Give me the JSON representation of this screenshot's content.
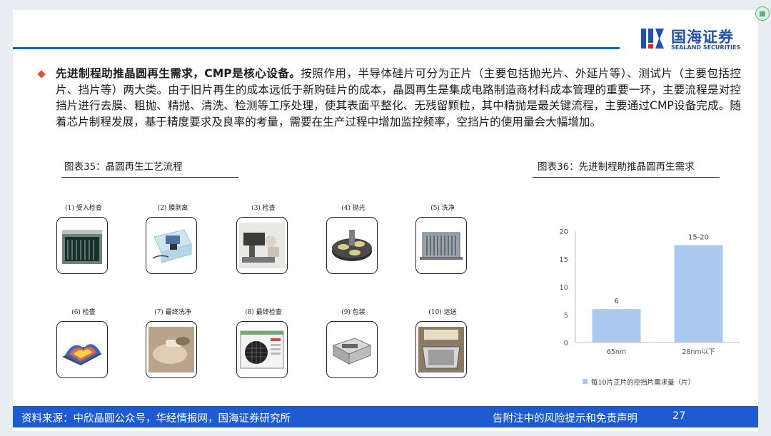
{
  "logo": {
    "cn": "国海证券",
    "en": "SEALAND SECURITIES"
  },
  "intro": {
    "lead": "先进制程助推晶圆再生需求，CMP是核心设备。",
    "text": "按照作用，半导体硅片可分为正片（主要包括抛光片、外延片等）、测试片（主要包括控片、挡片等）两大类。由于旧片再生的成本远低于新购硅片的成本，晶圆再生是集成电路制造商材料成本管理的重要一环，主要流程是对控挡片进行去膜、粗抛、精抛、清洗、检测等工序处理，使其表面平整化、无残留颗粒，其中精抛是最关键流程，主要通过CMP设备完成。随着芯片制程发展，基于精度要求及良率的考量，需要在生产过程中增加监控频率，空挡片的使用量会大幅增加。"
  },
  "figure35": {
    "title": "图表35：晶圆再生工艺流程",
    "steps": [
      {
        "label": "(1) 受入检查",
        "icon": "wafer-cassette"
      },
      {
        "label": "(2) 膜剥离",
        "icon": "film-strip-tank"
      },
      {
        "label": "(3) 检查",
        "icon": "microscope"
      },
      {
        "label": "(4) 抛光",
        "icon": "polishing-pad"
      },
      {
        "label": "(5) 洗净",
        "icon": "cleaning-rack"
      },
      {
        "label": "(6) 检查",
        "icon": "surface-map"
      },
      {
        "label": "(7) 最终洗净",
        "icon": "final-clean"
      },
      {
        "label": "(8) 最终检查",
        "icon": "inspection-screen"
      },
      {
        "label": "(9) 包装",
        "icon": "packaging-box"
      },
      {
        "label": "(10) 运送",
        "icon": "shipping-box"
      }
    ]
  },
  "figure36": {
    "title": "图表36：先进制程助推晶圆再生需求"
  },
  "chart_data": {
    "type": "bar",
    "categories": [
      "65nm",
      "28nm以下"
    ],
    "series": [
      {
        "name": "每10片正片的控挡片需求量（片）",
        "values": [
          6,
          17.5
        ],
        "value_labels": [
          "6",
          "15-20"
        ],
        "color": "#a9c9ef"
      }
    ],
    "ylim": [
      0,
      20
    ],
    "yticks": [
      "0",
      "5",
      "10",
      "15",
      "20"
    ],
    "legend": "bottom",
    "grid": false
  },
  "footer": {
    "source": "资料来源：中欣晶圆公众号，华经情报网，国海证券研究所",
    "disclaimer": "告附注中的风险提示和免责声明",
    "page": "27"
  },
  "colors": {
    "brand_blue": "#1e5bd3",
    "bullet": "#e2502b",
    "bar": "#a9c9ef"
  }
}
